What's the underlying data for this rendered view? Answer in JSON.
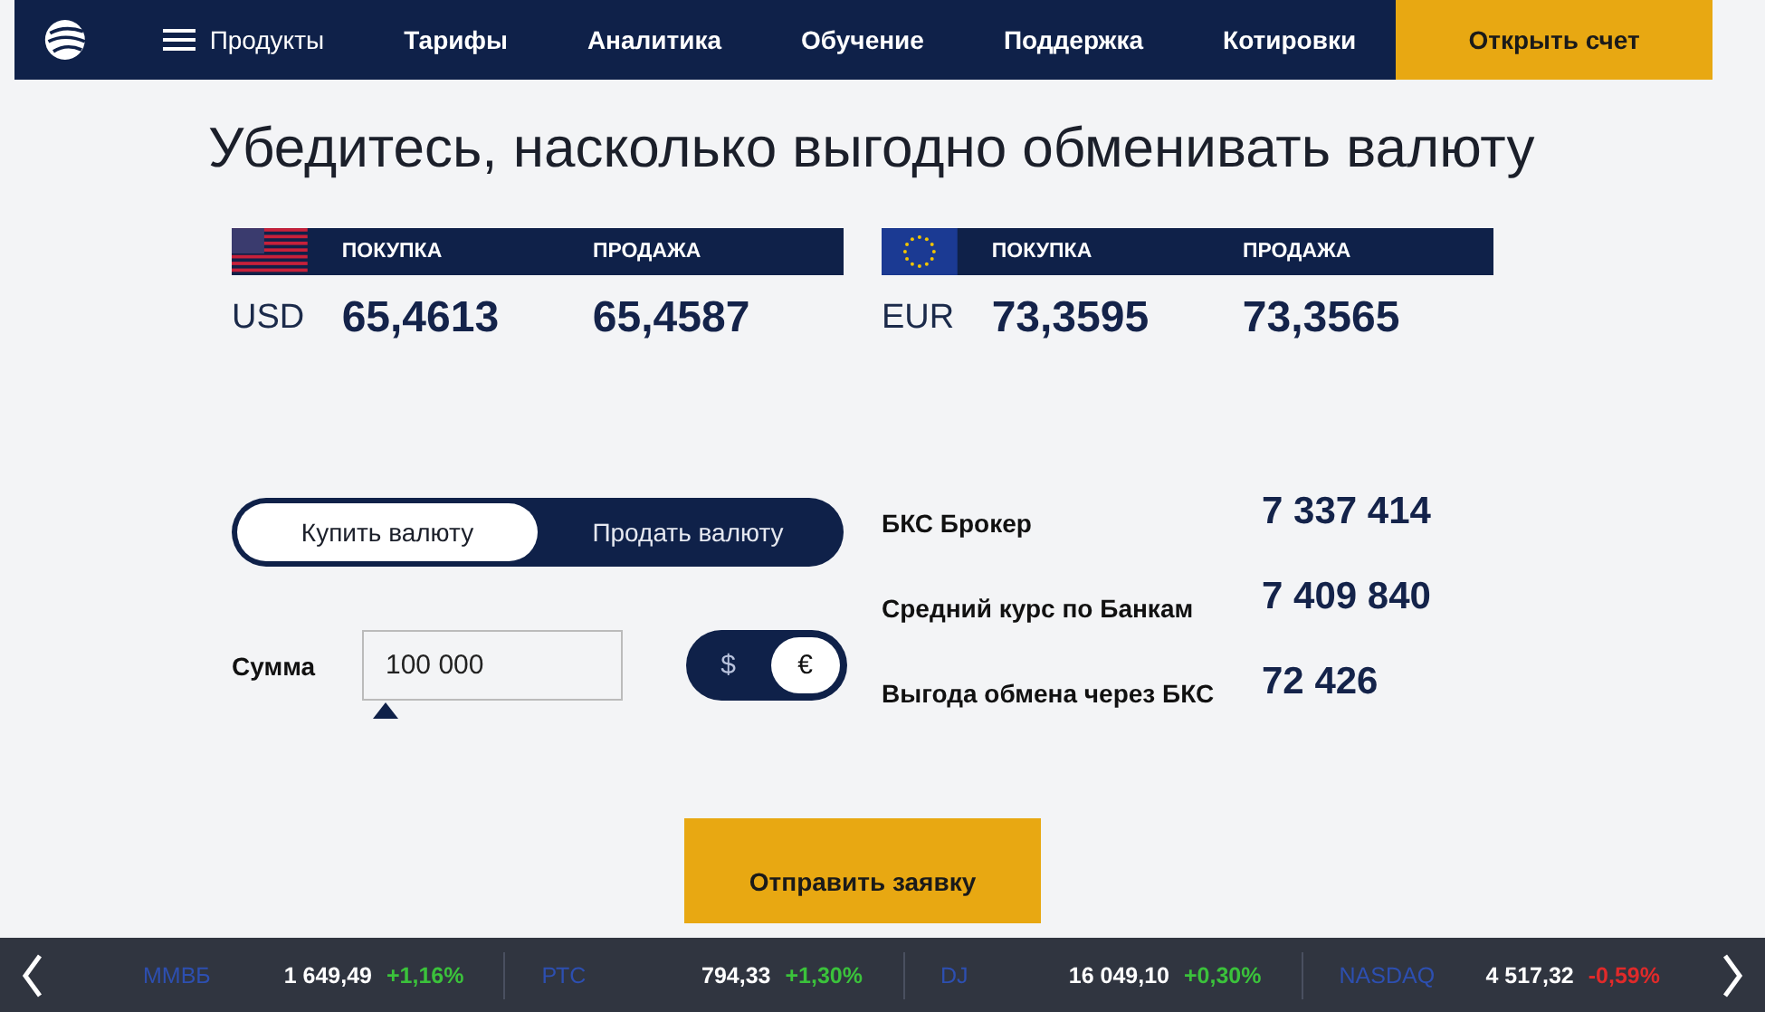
{
  "nav": {
    "menu_label": "Продукты",
    "items": [
      "Тарифы",
      "Аналитика",
      "Обучение",
      "Поддержка",
      "Котировки"
    ],
    "cta": "Открыть счет"
  },
  "heading": "Убедитесь, насколько выгодно обменивать валюту",
  "rates": [
    {
      "kind": "us",
      "buy_label": "ПОКУПКА",
      "sell_label": "ПРОДАЖА",
      "code": "USD",
      "buy": "65,4613",
      "sell": "65,4587"
    },
    {
      "kind": "eu",
      "buy_label": "ПОКУПКА",
      "sell_label": "ПРОДАЖА",
      "code": "EUR",
      "buy": "73,3595",
      "sell": "73,3565"
    }
  ],
  "mode_tabs": [
    {
      "label": "Купить валюту",
      "selected": true
    },
    {
      "label": "Продать валюту",
      "selected": false
    }
  ],
  "amount": {
    "label": "Сумма",
    "value": "100 000"
  },
  "currency_switch": [
    {
      "label": "$",
      "selected": false
    },
    {
      "label": "€",
      "selected": true
    }
  ],
  "results": [
    {
      "label": "БКС Брокер",
      "value": "7 337 414"
    },
    {
      "label": "Средний курс по Банкам",
      "value": "7 409 840"
    },
    {
      "label": "Выгода обмена через БКС",
      "value": "72 426"
    }
  ],
  "submit": "Отправить заявку",
  "ticker": [
    {
      "name": "ММВБ",
      "price": "1 649,49",
      "change": "+1,16%",
      "color": "#3bc23b"
    },
    {
      "name": "РТС",
      "price": "794,33",
      "change": "+1,30%",
      "color": "#3bc23b"
    },
    {
      "name": "DJ",
      "price": "16 049,10",
      "change": "+0,30%",
      "color": "#3bc23b"
    },
    {
      "name": "NASDAQ",
      "price": "4 517,32",
      "change": "-0,59%",
      "color": "#e02a2a"
    }
  ]
}
